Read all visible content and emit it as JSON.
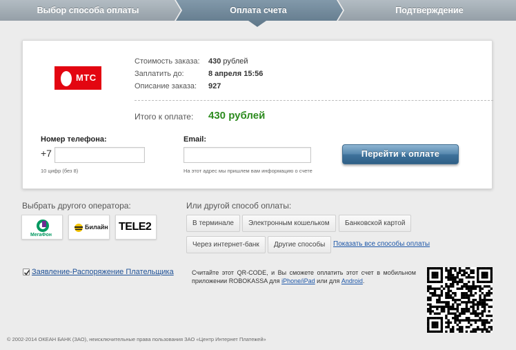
{
  "steps": {
    "step1": "Выбор способа оплаты",
    "step2": "Оплата счета",
    "step3": "Подтверждение",
    "active_color": "#6f8799",
    "inactive_color": "#9aa5ad"
  },
  "merchant": {
    "logo_text": "МТС",
    "brand_color": "#e30611"
  },
  "order": {
    "cost_label": "Стоимость заказа:",
    "cost_value": "430",
    "cost_unit": "рублей",
    "pay_until_label": "Заплатить до:",
    "pay_until_value": "8 апреля 15:56",
    "description_label": "Описание заказа:",
    "description_value": "927",
    "total_label": "Итого к оплате:",
    "total_value": "430 рублей",
    "total_color": "#2c8b1e"
  },
  "form": {
    "phone_label": "Номер телефона:",
    "phone_prefix": "+7",
    "phone_value": "",
    "phone_hint": "10 цифр (без 8)",
    "email_label": "Email:",
    "email_value": "",
    "email_hint": "На этот адрес мы пришлем вам информацию о счете",
    "pay_button": "Перейти к оплате"
  },
  "operators": {
    "title": "Выбрать другого оператора:",
    "items": [
      {
        "name": "МегаФон",
        "icon": "megafon-logo"
      },
      {
        "name": "Билайн",
        "icon": "beeline-logo"
      },
      {
        "name": "TELE2",
        "icon": "tele2-logo"
      }
    ]
  },
  "methods": {
    "title": "Или другой способ оплаты:",
    "terminal": "В терминале",
    "ewallet": "Электронным кошельком",
    "bank_card": "Банковской картой",
    "internet_bank": "Через интернет-банк",
    "other": "Другие способы",
    "show_all": "Показать все способы оплаты"
  },
  "consent": {
    "checked": true,
    "label": "Заявление-Распоряжение Плательщика"
  },
  "qr": {
    "text_before": "Считайте этот QR-CODE, и Вы сможете оплатить этот счет в мобильном приложении ROBOKASSA для ",
    "iphone_link": "iPhone/iPad",
    "text_middle": " или для ",
    "android_link": "Android",
    "text_after": "."
  },
  "footer": "© 2002-2014 ОКЕАН БАНК (ЗАО), неисключительные права пользования ЗАО «Центр Интернет Платежей»"
}
